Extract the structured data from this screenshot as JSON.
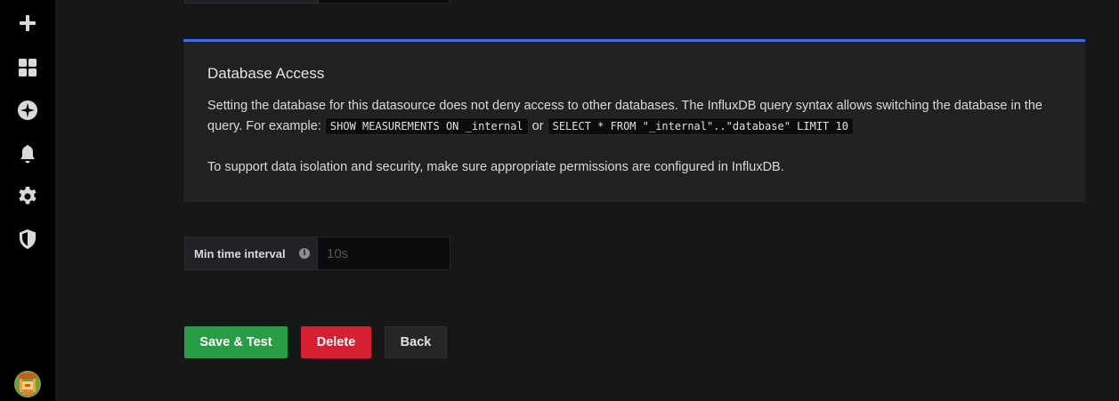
{
  "sidebar": {
    "items": [
      {
        "name": "create",
        "icon": "plus-icon"
      },
      {
        "name": "dashboards",
        "icon": "dashboards-grid-icon"
      },
      {
        "name": "explore",
        "icon": "compass-icon"
      },
      {
        "name": "alerting",
        "icon": "bell-icon"
      },
      {
        "name": "configuration",
        "icon": "gear-icon"
      },
      {
        "name": "server-admin",
        "icon": "shield-icon"
      }
    ]
  },
  "alert": {
    "title": "Database Access",
    "p1_text1": "Setting the database for this datasource does not deny access to other databases. The InfluxDB query syntax allows switching the database in the query. For example: ",
    "code1": "SHOW MEASUREMENTS ON _internal",
    "or_text": " or ",
    "code2": "SELECT * FROM \"_internal\"..\"database\" LIMIT 10",
    "p2": "To support data isolation and security, make sure appropriate permissions are configured in InfluxDB.",
    "accent_color": "#3274d9"
  },
  "min_time": {
    "label": "Min time interval",
    "info_icon": "i",
    "placeholder": "10s"
  },
  "buttons": {
    "save": "Save & Test",
    "delete": "Delete",
    "back": "Back"
  },
  "colors": {
    "save": "#299c46",
    "delete": "#d81e32"
  }
}
